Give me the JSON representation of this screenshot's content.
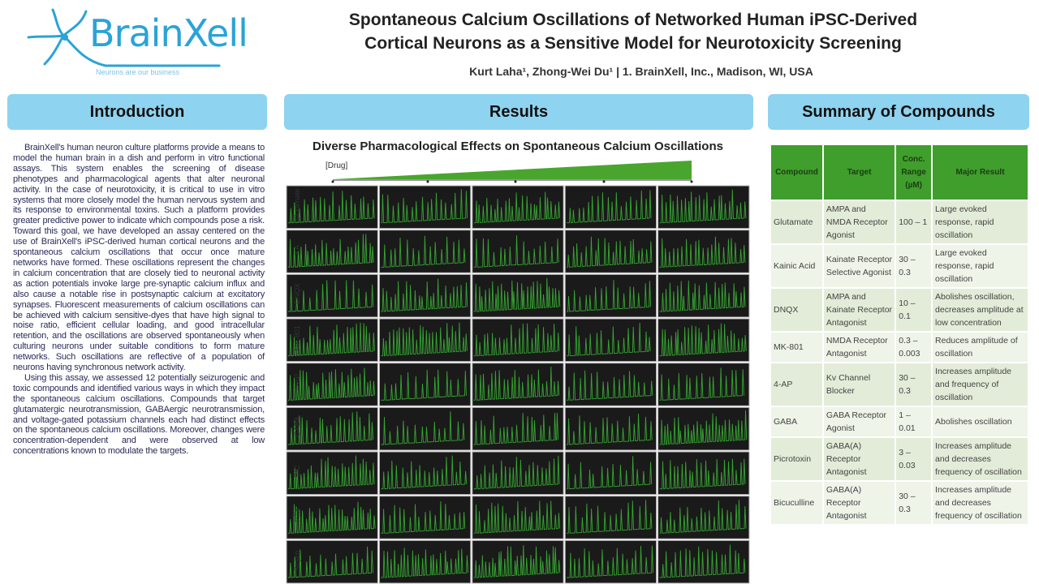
{
  "logo": {
    "name": "BrainXell",
    "tagline": "Neurons are our business"
  },
  "header": {
    "title_line1": "Spontaneous Calcium Oscillations of Networked Human iPSC-Derived",
    "title_line2": "Cortical Neurons as a Sensitive Model for Neurotoxicity Screening",
    "authors": "Kurt Laha¹, Zhong-Wei Du¹ |  1. BrainXell, Inc., Madison, WI, USA"
  },
  "sections": {
    "introduction": "Introduction",
    "results": "Results",
    "summary": "Summary of Compounds"
  },
  "introduction": {
    "paragraphs": [
      "BrainXell's human neuron culture platforms provide a means to model the human brain in a dish and perform in vitro functional assays. This system enables the screening of disease phenotypes and pharmacological agents that alter neuronal activity.  In the case of neurotoxicity, it is critical to use in vitro systems that more closely model the human nervous system and its response to environmental toxins. Such a platform provides greater predictive power to indicate which compounds pose a risk. Toward this goal, we have developed an assay centered on the use of BrainXell's iPSC-derived human cortical neurons and the spontaneous calcium oscillations that occur once mature networks have formed.  These oscillations represent the changes in calcium concentration that are closely tied to neuronal activity as action potentials invoke large pre-synaptic calcium influx and also cause a notable rise in postsynaptic calcium at excitatory synapses. Fluorescent measurements of calcium oscillations can be achieved with calcium sensitive-dyes that have high signal to noise ratio, efficient cellular loading, and good intracellular retention, and the oscillations are observed spontaneously when culturing neurons under suitable conditions to form mature networks. Such oscillations are reflective of a population of neurons having synchronous network activity.",
      "Using this assay, we assessed 12 potentially seizurogenic and toxic compounds and identified various ways in which they impact the spontaneous calcium oscillations. Compounds that target glutamatergic neurotransmission, GABAergic neurotransmission, and voltage-gated potassium channels each had distinct effects on the spontaneous calcium oscillations. Moreover, changes were concentration-dependent and were observed at low concentrations known to modulate the targets."
    ]
  },
  "results": {
    "figure_title": "Diverse Pharmacological Effects on Spontaneous Calcium Oscillations",
    "drug_label": "[Drug]",
    "row_labels": [
      "Glutamate",
      "KA",
      "DNQX",
      "MK-801",
      "4-AP",
      "GABA",
      "BIC",
      "PTX",
      "Strych."
    ],
    "trace_color": "#3fd43a",
    "panel_bg": "#1a1a1a"
  },
  "summary_table": {
    "headers": [
      "Compound",
      "Target",
      "Conc. Range (µM)",
      "Major Result"
    ],
    "rows": [
      [
        "Glutamate",
        "AMPA and NMDA Receptor Agonist",
        "100 – 1",
        "Large evoked response, rapid oscillation"
      ],
      [
        "Kainic Acid",
        "Kainate Receptor Selective Agonist",
        "30 – 0.3",
        "Large evoked response, rapid oscillation"
      ],
      [
        "DNQX",
        "AMPA and Kainate Receptor Antagonist",
        "10 – 0.1",
        "Abolishes oscillation, decreases amplitude at low concentration"
      ],
      [
        "MK-801",
        "NMDA Receptor Antagonist",
        "0.3 – 0.003",
        "Reduces amplitude of oscillation"
      ],
      [
        "4-AP",
        "Kv Channel Blocker",
        "30 – 0.3",
        "Increases amplitude and frequency of oscillation"
      ],
      [
        "GABA",
        "GABA Receptor Agonist",
        "1 – 0.01",
        "Abolishes oscillation"
      ],
      [
        "Picrotoxin",
        "GABA(A) Receptor Antagonist",
        "3 – 0.03",
        "Increases amplitude and decreases frequency of oscillation"
      ],
      [
        "Bicuculline",
        "GABA(A) Receptor Antagonist",
        "30 – 0.3",
        "Increases amplitude and decreases frequency of oscillation"
      ]
    ],
    "header_color": "#3f9e2c"
  }
}
